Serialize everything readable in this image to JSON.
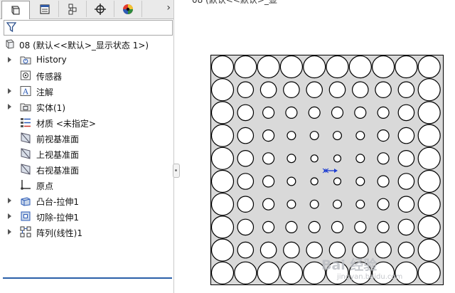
{
  "toolbar": {
    "tabs": [
      {
        "icon": "feature-manager-icon",
        "active": true
      },
      {
        "icon": "property-manager-icon",
        "active": false
      },
      {
        "icon": "configuration-manager-icon",
        "active": false
      },
      {
        "icon": "dimxpert-manager-icon",
        "active": false
      },
      {
        "icon": "display-manager-icon",
        "active": false
      }
    ],
    "more_icon": "chevron-right-icon"
  },
  "filter": {
    "icon": "funnel-icon"
  },
  "tree": {
    "root_label": "08  (默认<<默认>_显示状态 1>)",
    "items": [
      {
        "label": "History",
        "icon": "history-folder-icon",
        "expandable": true
      },
      {
        "label": "传感器",
        "icon": "sensors-icon",
        "expandable": false
      },
      {
        "label": "注解",
        "icon": "annotations-icon",
        "expandable": true
      },
      {
        "label": "实体(1)",
        "icon": "solid-bodies-icon",
        "expandable": true
      },
      {
        "label": "材质 <未指定>",
        "icon": "material-icon",
        "expandable": false
      },
      {
        "label": "前视基准面",
        "icon": "plane-icon",
        "expandable": false
      },
      {
        "label": "上视基准面",
        "icon": "plane-icon",
        "expandable": false
      },
      {
        "label": "右视基准面",
        "icon": "plane-icon",
        "expandable": false
      },
      {
        "label": "原点",
        "icon": "origin-icon",
        "expandable": false
      },
      {
        "label": "凸台-拉伸1",
        "icon": "boss-extrude-icon",
        "expandable": true
      },
      {
        "label": "切除-拉伸1",
        "icon": "cut-extrude-icon",
        "expandable": true
      },
      {
        "label": "阵列(线性)1",
        "icon": "linear-pattern-icon",
        "expandable": true
      }
    ]
  },
  "graphics": {
    "title": "08 (默认<<默认>_显",
    "grid": {
      "rows": 10,
      "cols": 10
    },
    "watermark": "Bai 经验",
    "watermark_sub": "jingyan.baidu.com",
    "colors": {
      "plate": "#d9d9d9",
      "hole": "#ffffff",
      "origin": "#1f3fd1",
      "edge": "#000000"
    }
  }
}
